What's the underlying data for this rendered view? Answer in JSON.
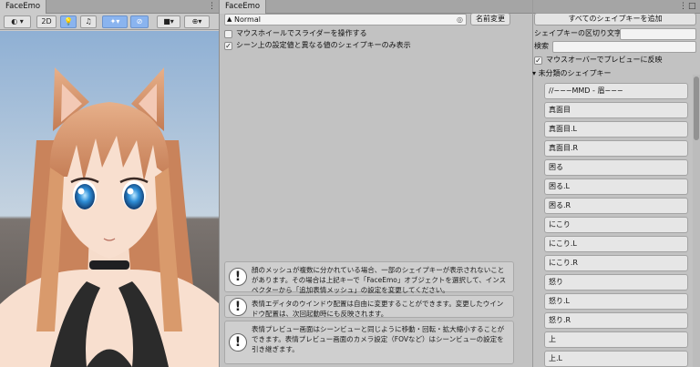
{
  "scene_panel": {
    "tab_label": "FaceEmo",
    "toolbar": {
      "shading_label": "",
      "mode_2d_label": "2D",
      "gizmos_label": ""
    }
  },
  "editor_panel": {
    "tab_label": "FaceEmo",
    "menu_name_value": "Normal",
    "rename_button_label": "名前変更",
    "scroll_wheel_label": "マウスホイールでスライダーを操作する",
    "scroll_wheel_checked": false,
    "only_changed_label": "シーン上の設定値と異なる値のシェイプキーのみ表示",
    "only_changed_checked": true,
    "help_messages": [
      {
        "text": "顔のメッシュが複数に分かれている場合、一部のシェイプキーが表示されないことがあります。その場合は上記キーで「FaceEmo」オブジェクトを選択して、インスペクターから「追加表情メッシュ」の設定を変更してください。"
      },
      {
        "text": "表情エディタのウインドウ配置は自由に変更することができます。変更したウインドウ配置は、次回起動時にも反映されます。"
      },
      {
        "text": "表情プレビュー画面はシーンビューと同じように移動・回転・拡大縮小することができます。表情プレビュー画面のカメラ設定（FOVなど）はシーンビューの設定を引き継ぎます。"
      }
    ]
  },
  "shapekey_panel": {
    "add_all_button_label": "すべてのシェイプキーを追加",
    "delimiter_label": "シェイプキーの区切り文字",
    "delimiter_value": "",
    "search_label": "検索",
    "search_value": "",
    "mouseover_preview_label": "マウスオーバーでプレビューに反映",
    "mouseover_preview_checked": true,
    "group_label": "未分類のシェイプキー",
    "keys": [
      "//−−−MMD - 眉−−−",
      "真面目",
      "真面目.L",
      "真面目.R",
      "困る",
      "困る.L",
      "困る.R",
      "にこり",
      "にこり.L",
      "にこり.R",
      "怒り",
      "怒り.L",
      "怒り.R",
      "上",
      "上.L"
    ]
  },
  "colors": {
    "panel_bg": "#c2c2c2",
    "tab_active": "#cbcbcb",
    "toolbar_active": "#8ab4ef",
    "hair": "#d99a6c",
    "skin": "#f8dfcf",
    "eye": "#2f8fd8"
  }
}
